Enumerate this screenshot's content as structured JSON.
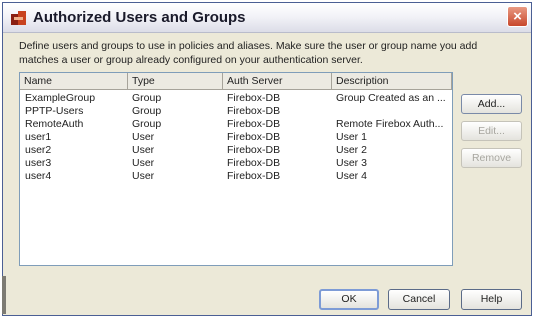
{
  "dialog": {
    "title": "Authorized Users and Groups",
    "close_glyph": "×",
    "description": "Define users and groups to use in policies and aliases. Make sure the user or group name you add matches a user or group already configured on your authentication server."
  },
  "table": {
    "columns": [
      "Name",
      "Type",
      "Auth Server",
      "Description"
    ],
    "rows": [
      [
        "ExampleGroup",
        "Group",
        "Firebox-DB",
        "Group Created as an ..."
      ],
      [
        "PPTP-Users",
        "Group",
        "Firebox-DB",
        ""
      ],
      [
        "RemoteAuth",
        "Group",
        "Firebox-DB",
        "Remote Firebox Auth..."
      ],
      [
        "user1",
        "User",
        "Firebox-DB",
        "User 1"
      ],
      [
        "user2",
        "User",
        "Firebox-DB",
        "User 2"
      ],
      [
        "user3",
        "User",
        "Firebox-DB",
        "User 3"
      ],
      [
        "user4",
        "User",
        "Firebox-DB",
        "User 4"
      ]
    ]
  },
  "side_buttons": {
    "add": "Add...",
    "edit": "Edit...",
    "remove": "Remove"
  },
  "footer_buttons": {
    "ok": "OK",
    "cancel": "Cancel",
    "help": "Help"
  },
  "colors": {
    "dialog_background": "#ece9d8",
    "close_button": "#c8482c",
    "disabled_text": "#a7a69f"
  }
}
